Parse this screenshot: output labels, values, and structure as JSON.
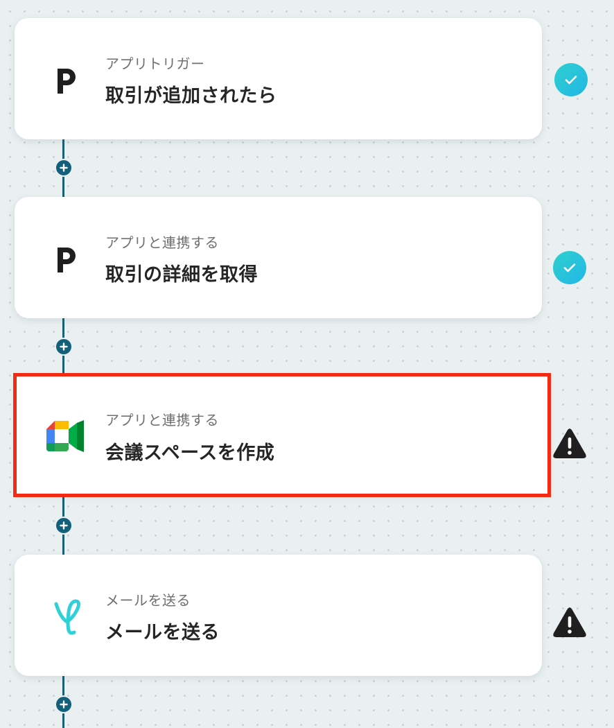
{
  "steps": [
    {
      "subtitle": "アプリトリガー",
      "title": "取引が追加されたら",
      "app_icon": "pipedrive-icon",
      "status": "complete"
    },
    {
      "subtitle": "アプリと連携する",
      "title": "取引の詳細を取得",
      "app_icon": "pipedrive-icon",
      "status": "complete"
    },
    {
      "subtitle": "アプリと連携する",
      "title": "会議スペースを作成",
      "app_icon": "google-meet-icon",
      "status": "warning",
      "highlighted": true
    },
    {
      "subtitle": "メールを送る",
      "title": "メールを送る",
      "app_icon": "mail-icon",
      "status": "warning"
    }
  ],
  "colors": {
    "background": "#eaf0f1",
    "connector": "#13607d",
    "check": "#22c3dc",
    "warning": "#1f1f1f",
    "highlight": "#f42a12",
    "mail_brand": "#2fd0d6"
  }
}
